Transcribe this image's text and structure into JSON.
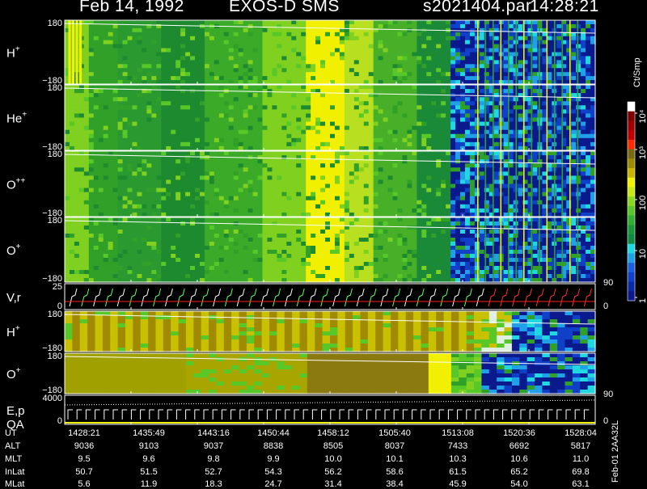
{
  "header": {
    "date": "Feb 14, 1992",
    "instrument": "EXOS-D SMS",
    "file": "s2021404.par",
    "time": "14:28:21"
  },
  "chart_data": {
    "type": "heatmap",
    "panels": [
      {
        "id": "h_plus",
        "label_main": "H",
        "label_sup": "+",
        "ymax": "180",
        "ymin": "−180"
      },
      {
        "id": "he_plus",
        "label_main": "He",
        "label_sup": "+",
        "ymax": "180",
        "ymin": "−180"
      },
      {
        "id": "o_pp",
        "label_main": "O",
        "label_sup": "++",
        "ymax": "180",
        "ymin": "−180"
      },
      {
        "id": "o_plus",
        "label_main": "O",
        "label_sup": "+",
        "ymax": "180",
        "ymin": "−180"
      },
      {
        "id": "vr",
        "label_main": "V,r",
        "label_sup": "",
        "ymax": "25",
        "ymin": "0",
        "right_top": "90",
        "right_bottom": "0"
      },
      {
        "id": "h_plus_2",
        "label_main": "H",
        "label_sup": "+",
        "ymax": "180",
        "ymin": "−180"
      },
      {
        "id": "o_plus_2",
        "label_main": "O",
        "label_sup": "+",
        "ymax": "180",
        "ymin": "−180"
      },
      {
        "id": "ep_qa",
        "label_main": "E,p",
        "label_line2": "QA",
        "ymax": "4000",
        "ymin": "0",
        "right_top": "90",
        "right_bottom": "0"
      }
    ],
    "colorbar": {
      "unit": "Ct/Smp",
      "tick_labels": [
        "1",
        "10",
        "100",
        "10³",
        "10⁴"
      ],
      "colors": [
        "#0a1a8c",
        "#0a2aa8",
        "#1040c8",
        "#1a60e0",
        "#20a0e8",
        "#20d8e0",
        "#108a40",
        "#189a38",
        "#30b030",
        "#58c828",
        "#88d820",
        "#c8e818",
        "#f0f000",
        "#c8b400",
        "#a08a00",
        "#7a6a10",
        "#ff2a00",
        "#c00000",
        "#a00000",
        "#800000",
        "#ffffff"
      ]
    },
    "footer": {
      "rows": [
        {
          "label": "UT",
          "values": [
            "1428:21",
            "1435:49",
            "1443:16",
            "1450:44",
            "1458:12",
            "1505:40",
            "1513:08",
            "1520:36",
            "1528:04"
          ]
        },
        {
          "label": "ALT",
          "values": [
            "9036",
            "9103",
            "9037",
            "8838",
            "8505",
            "8037",
            "7433",
            "6692",
            "5817"
          ]
        },
        {
          "label": "MLT",
          "values": [
            "9.5",
            "9.6",
            "9.8",
            "9.9",
            "10.0",
            "10.1",
            "10.3",
            "10.6",
            "11.0"
          ]
        },
        {
          "label": "InLat",
          "values": [
            "50.7",
            "51.5",
            "52.7",
            "54.3",
            "56.2",
            "58.6",
            "61.5",
            "65.2",
            "69.8"
          ]
        },
        {
          "label": "MLat",
          "values": [
            "5.6",
            "11.9",
            "18.3",
            "24.7",
            "31.4",
            "38.4",
            "45.9",
            "54.0",
            "63.1"
          ]
        }
      ],
      "side_label": "Feb-01 2AA32L"
    }
  }
}
